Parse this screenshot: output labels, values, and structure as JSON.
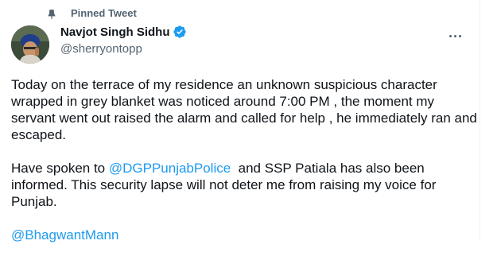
{
  "header": {
    "pinned_label": "Pinned Tweet"
  },
  "author": {
    "name": "Navjot Singh Sidhu",
    "handle": "@sherryontopp",
    "verified": true
  },
  "tweet": {
    "paragraph1": "Today on the terrace of my residence an unknown suspicious character wrapped in grey blanket was noticed around 7:00 PM , the moment my servant went out raised the alarm and called for help , he immediately ran and escaped.",
    "paragraph2_before": "Have spoken to ",
    "paragraph2_mention": "@DGPPunjabPolice",
    "paragraph2_after": "  and SSP Patiala has also been informed. This security lapse will not deter me from raising my voice for Punjab.",
    "closing_mention": "@BhagwantMann"
  },
  "icons": {
    "pin": "pin-icon",
    "verified": "verified-badge-icon",
    "more": "more-options-icon"
  },
  "colors": {
    "link": "#1d9bf0",
    "secondary_text": "#536471",
    "primary_text": "#0f1419",
    "verified": "#1d9bf0"
  }
}
